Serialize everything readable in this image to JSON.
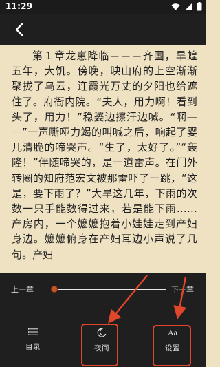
{
  "status": {
    "time": "11:29"
  },
  "content": {
    "paragraph": "第１章龙崽降临＝＝＝齐国，旱蝗五年，大饥。傍晚，映山府的上空渐渐聚拢了乌云，连霞光万丈的夕阳也给遮住了。府衙内院。“夫人，用力啊！看到头了，用力！”稳婆边擦汗边喊。“啊—－”一声嘶哑力竭的叫喊之后，响起了婴儿清脆的啼哭声。“生了，太好了。”“轰隆！”伴随啼哭的，是一道雷声。在门外转圈的知府范宏文被那雷吓了一跳，“这是，要下雨了？”大旱这几年，下雨的次数一只手能数得过来，若是能下雨……产房内，一个嬷嬷抱着小娃娃走到产妇身边。嬷嬷俯身在产妇耳边小声说了几句。产妇"
  },
  "controls": {
    "prev_chapter": "上一章",
    "next_chapter": "下一章",
    "progress": 0.0
  },
  "nav": {
    "catalog_label": "目录",
    "night_label": "夜间",
    "settings_label": "设置",
    "settings_icon_text": "Aa"
  },
  "colors": {
    "page_background": "#efe2c3",
    "toolbar": "#1f1f1f",
    "highlight": "#e0462a",
    "slider_thumb": "#c4562c"
  },
  "icons": {
    "back": "chevron-left-icon",
    "catalog": "list-icon",
    "night": "moon-icon",
    "settings": "font-aa-icon"
  }
}
